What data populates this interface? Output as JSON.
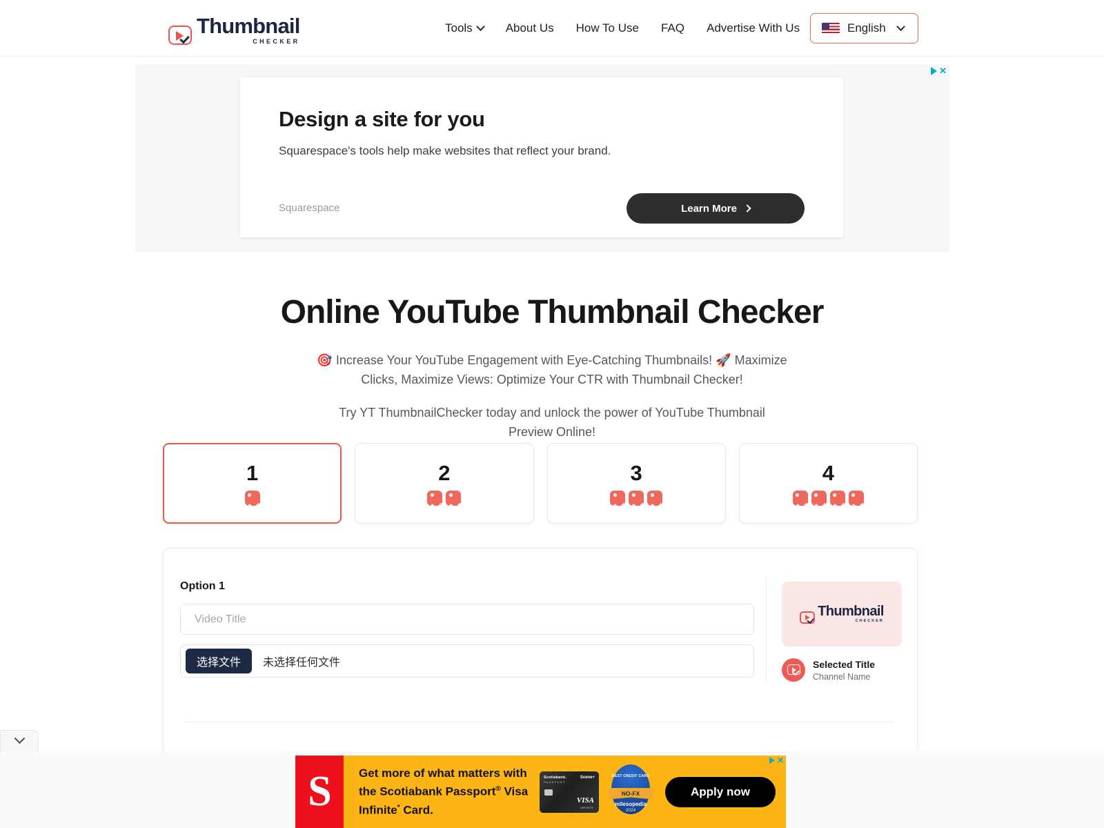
{
  "header": {
    "logo": {
      "word": "Thumbnail",
      "sub": "CHECKER",
      "icon": "play-check-logo"
    },
    "nav": [
      {
        "label": "Tools",
        "has_chevron": true
      },
      {
        "label": "About Us",
        "has_chevron": false
      },
      {
        "label": "How To Use",
        "has_chevron": false
      },
      {
        "label": "FAQ",
        "has_chevron": false
      },
      {
        "label": "Advertise With Us",
        "has_chevron": false
      }
    ],
    "language": {
      "label": "English",
      "flag": "us-flag-icon",
      "chevron": "chevron-down-icon",
      "border_color": "#E8675E"
    }
  },
  "top_ad": {
    "adchoices": "▷",
    "close": "✕",
    "headline": "Design a site for you",
    "body": "Squarespace's tools help make websites that reflect your brand.",
    "brand": "Squarespace",
    "cta": "Learn More"
  },
  "hero": {
    "title": "Online YouTube Thumbnail Checker",
    "subtitle": "🎯 Increase Your YouTube Engagement with Eye-Catching Thumbnails! 🚀 Maximize Clicks, Maximize Views: Optimize Your CTR with Thumbnail Checker!",
    "subtitle2": "Try YT ThumbnailChecker today and unlock the power of YouTube Thumbnail Preview Online!"
  },
  "option_cards": [
    {
      "number": "1",
      "image_count": 1,
      "selected": true
    },
    {
      "number": "2",
      "image_count": 2,
      "selected": false
    },
    {
      "number": "3",
      "image_count": 3,
      "selected": false
    },
    {
      "number": "4",
      "image_count": 4,
      "selected": false
    }
  ],
  "form": {
    "option_label": "Option 1",
    "title_placeholder": "Video Title",
    "title_value": "",
    "file_button": "选择文件",
    "file_status": "未选择任何文件"
  },
  "preview": {
    "thumbnail_logo_word": "Thumbnail",
    "thumbnail_logo_sub": "CHECKER",
    "video_title": "Selected Title",
    "channel_name": "Channel Name"
  },
  "bottom_bar": {
    "chevron": "chevron-down-icon"
  },
  "bottom_ad": {
    "adchoices": "▷",
    "close": "✕",
    "brand_mark": "S",
    "headline_l1": "Get more of what matters with",
    "headline_l2": "the Scotiabank Passport",
    "headline_sup1": "®",
    "headline_l2b": " Visa",
    "headline_l3": "Infinite",
    "headline_sup2": "*",
    "headline_l3b": " Card.",
    "card_brand": "Scotiabank.",
    "card_brand_sub": "PASSPORT",
    "card_scene": "Scene+",
    "card_network": "VISA",
    "card_tier": "INFINITE",
    "badge_top": "BEST CREDIT CARD",
    "badge_ribbon": "NO-FX",
    "badge_mid": "milesopedia",
    "badge_year": "2024",
    "cta": "Apply now"
  },
  "colors": {
    "accent": "#E8554C",
    "navy": "#1C2541",
    "ad_yellow": "#FDB515",
    "scotiabank_red": "#EC111A"
  }
}
